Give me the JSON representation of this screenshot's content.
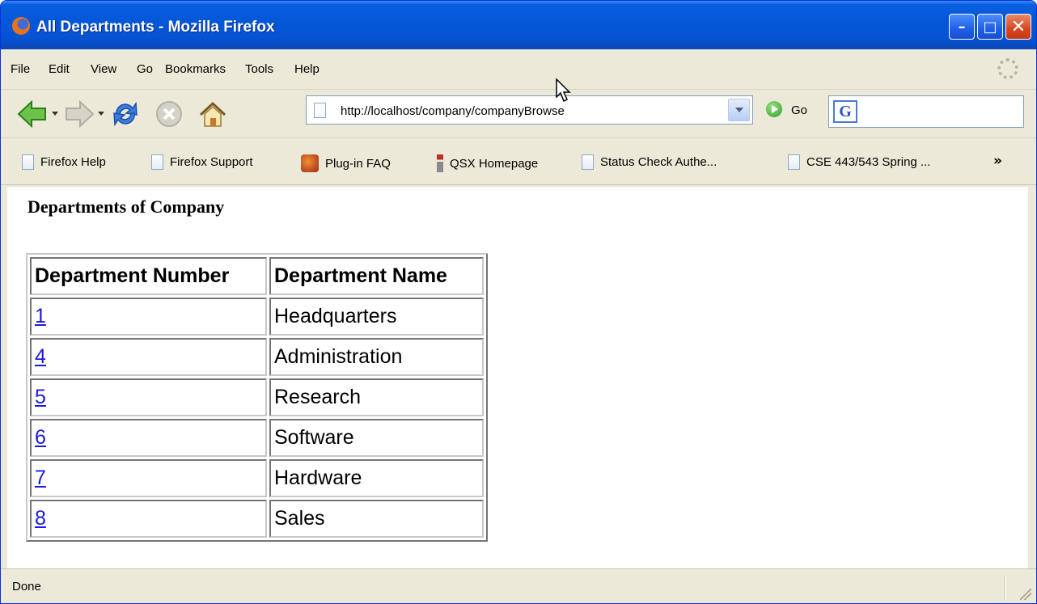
{
  "window": {
    "title": "All Departments - Mozilla Firefox",
    "min_glyph": "–",
    "max_glyph": "□",
    "close_glyph": "✕"
  },
  "menu": {
    "items": [
      "File",
      "Edit",
      "View",
      "Go",
      "Bookmarks",
      "Tools",
      "Help"
    ]
  },
  "nav": {
    "url": "http://localhost/company/companyBrowse",
    "go_label": "Go",
    "search_logo": "G"
  },
  "bookmarks": {
    "items": [
      {
        "label": "Firefox Help",
        "icon": "page-icon"
      },
      {
        "label": "Firefox Support",
        "icon": "page-icon"
      },
      {
        "label": "Plug-in FAQ",
        "icon": "plugin-icon"
      },
      {
        "label": "QSX Homepage",
        "icon": "info-icon"
      },
      {
        "label": "Status Check Authe...",
        "icon": "page-icon"
      },
      {
        "label": "CSE 443/543 Spring ...",
        "icon": "page-icon"
      }
    ],
    "more": "»"
  },
  "page": {
    "heading": "Departments of Company",
    "table": {
      "headers": [
        "Department Number",
        "Department Name"
      ],
      "rows": [
        {
          "number": "1",
          "name": "Headquarters"
        },
        {
          "number": "4",
          "name": "Administration"
        },
        {
          "number": "5",
          "name": "Research"
        },
        {
          "number": "6",
          "name": "Software"
        },
        {
          "number": "7",
          "name": "Hardware"
        },
        {
          "number": "8",
          "name": "Sales"
        }
      ]
    }
  },
  "status": {
    "text": "Done"
  },
  "colors": {
    "titlebar": "#0458d8",
    "chrome": "#ece9d8",
    "link": "#1a1adf"
  }
}
